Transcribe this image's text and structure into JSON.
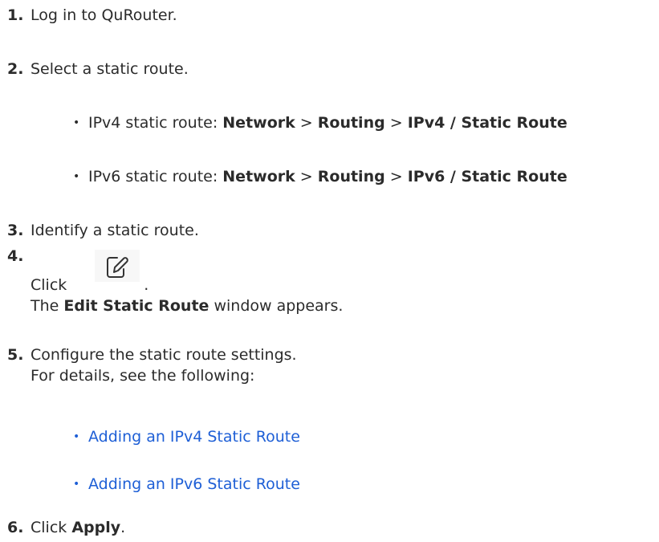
{
  "steps": [
    {
      "number": "1.",
      "text": "Log in to QuRouter."
    },
    {
      "number": "2.",
      "text": "Select a static route.",
      "sub": [
        {
          "prefix": "IPv4 static route: ",
          "p1": "Network",
          "sep1": " > ",
          "p2": "Routing",
          "sep2": " > ",
          "p3": "IPv4 / Static Route"
        },
        {
          "prefix": "IPv6 static route: ",
          "p1": "Network",
          "sep1": " > ",
          "p2": "Routing",
          "sep2": " > ",
          "p3": "IPv6 / Static Route"
        }
      ]
    },
    {
      "number": "3.",
      "text": "Identify a static route."
    },
    {
      "number": "4.",
      "click": "Click",
      "period": ".",
      "result_pre": "The ",
      "result_bold": "Edit Static Route",
      "result_post": " window appears."
    },
    {
      "number": "5.",
      "text": "Configure the static route settings.",
      "text2": "For details, see the following:",
      "links": [
        "Adding an IPv4 Static Route",
        "Adding an IPv6 Static Route"
      ]
    },
    {
      "number": "6.",
      "click": "Click ",
      "bold": "Apply",
      "period": "."
    }
  ],
  "bullet_char": "•",
  "icons": {
    "edit": "edit-icon"
  }
}
